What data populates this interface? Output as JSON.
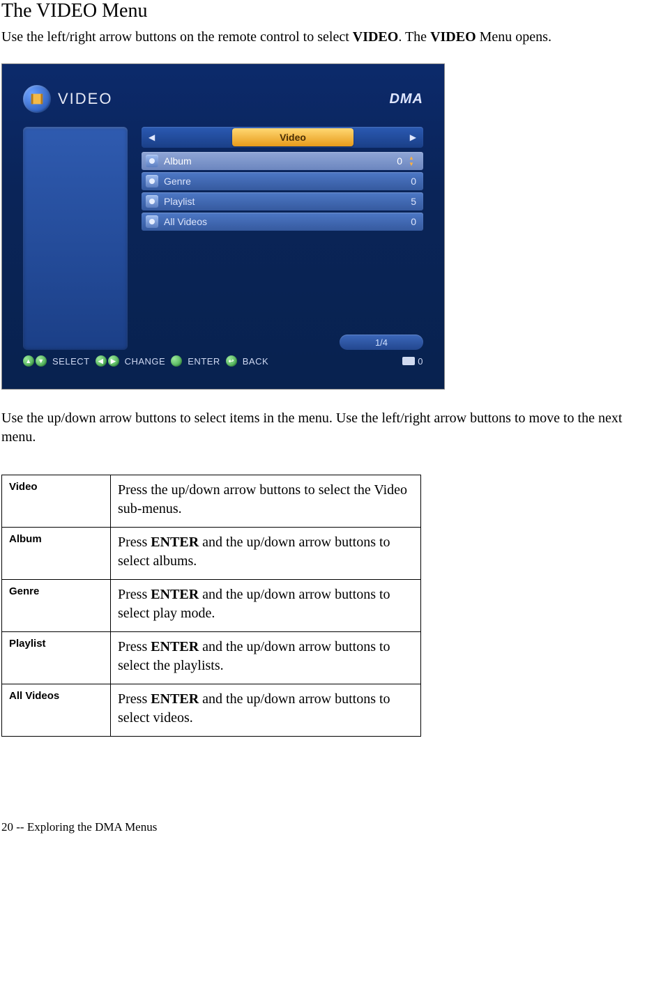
{
  "section_title": "The VIDEO Menu",
  "intro": {
    "pre": "Use the left/right arrow buttons on the remote control to select ",
    "bold1": "VIDEO",
    "mid": ". The ",
    "bold2": "VIDEO",
    "post": " Menu opens."
  },
  "screenshot": {
    "badge_text": "VIDEO",
    "brand": "DMA",
    "tab_label": "Video",
    "items": [
      {
        "label": "Album",
        "value": "0",
        "selected": true
      },
      {
        "label": "Genre",
        "value": "0",
        "selected": false
      },
      {
        "label": "Playlist",
        "value": "5",
        "selected": false
      },
      {
        "label": "All Videos",
        "value": "0",
        "selected": false
      }
    ],
    "position": "1/4",
    "hints": {
      "select": "SELECT",
      "change": "CHANGE",
      "enter": "ENTER",
      "back": "BACK",
      "card_count": "0"
    }
  },
  "para2": "Use the up/down arrow buttons to select items in the menu. Use the left/right arrow buttons to move to the next menu.",
  "definitions": [
    {
      "term": "Video",
      "desc_pre": "Press the up/down arrow buttons to select the Video sub-menus.",
      "desc_bold": "",
      "desc_post": ""
    },
    {
      "term": "Album",
      "desc_pre": "Press ",
      "desc_bold": "ENTER",
      "desc_post": " and the up/down arrow buttons to select albums."
    },
    {
      "term": "Genre",
      "desc_pre": "Press ",
      "desc_bold": "ENTER",
      "desc_post": " and the up/down arrow buttons to select play mode."
    },
    {
      "term": "Playlist",
      "desc_pre": "Press ",
      "desc_bold": "ENTER",
      "desc_post": " and the up/down arrow buttons to select the playlists."
    },
    {
      "term": "All Videos",
      "desc_pre": "Press ",
      "desc_bold": "ENTER",
      "desc_post": " and the up/down arrow buttons to select videos."
    }
  ],
  "footer": "20  --  Exploring the DMA Menus"
}
